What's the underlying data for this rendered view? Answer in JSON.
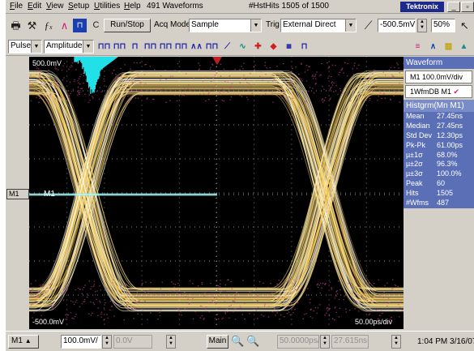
{
  "menu": {
    "items": [
      "File",
      "Edit",
      "View",
      "Setup",
      "Utilities",
      "Help"
    ],
    "waveform_count": "491 Waveforms",
    "hist_hits": "#HstHits  1505 of 1500",
    "brand": "Tektronix"
  },
  "toolbar": {
    "c_label": "C",
    "run_stop": "Run/Stop",
    "acq_mode_label": "Acq Mode",
    "acq_mode_value": "Sample",
    "trig_label": "Trig",
    "trig_source": "External Direct",
    "trig_level": "-500.5mV",
    "zoom": "50%"
  },
  "toolbar2": {
    "mode_value": "Pulse",
    "measure_value": "Amplitude"
  },
  "plot": {
    "top_label": "500.0mV",
    "bottom_label": "-500.0mV",
    "timebase_label": "50.00ps/div",
    "channel_label": "M1",
    "channel_marker": "M1"
  },
  "waveform_panel": {
    "title": "Waveform",
    "scale": "M1 100.0mV/div",
    "db_label": "1WfmDB M1"
  },
  "histogram": {
    "title": "Histgrm(Mn M1)",
    "stats": [
      {
        "k": "Mean",
        "v": "27.45ns"
      },
      {
        "k": "Median",
        "v": "27.45ns"
      },
      {
        "k": "Std Dev",
        "v": "12.30ps"
      },
      {
        "k": "Pk-Pk",
        "v": "61.00ps"
      },
      {
        "k": "µ±1σ",
        "v": "68.0%"
      },
      {
        "k": "µ±2σ",
        "v": "96.3%"
      },
      {
        "k": "µ±3σ",
        "v": "100.0%"
      },
      {
        "k": "Peak",
        "v": "60"
      },
      {
        "k": "Hits",
        "v": "1505"
      },
      {
        "k": "#Wfms",
        "v": "487"
      }
    ]
  },
  "bottombar": {
    "channel": "M1",
    "vscale": "100.0mV/",
    "offset": "0.0V",
    "main": "Main",
    "hscale": "50.0000ps/",
    "position": "27.615ns",
    "datetime": "1:04 PM 3/16/07"
  }
}
